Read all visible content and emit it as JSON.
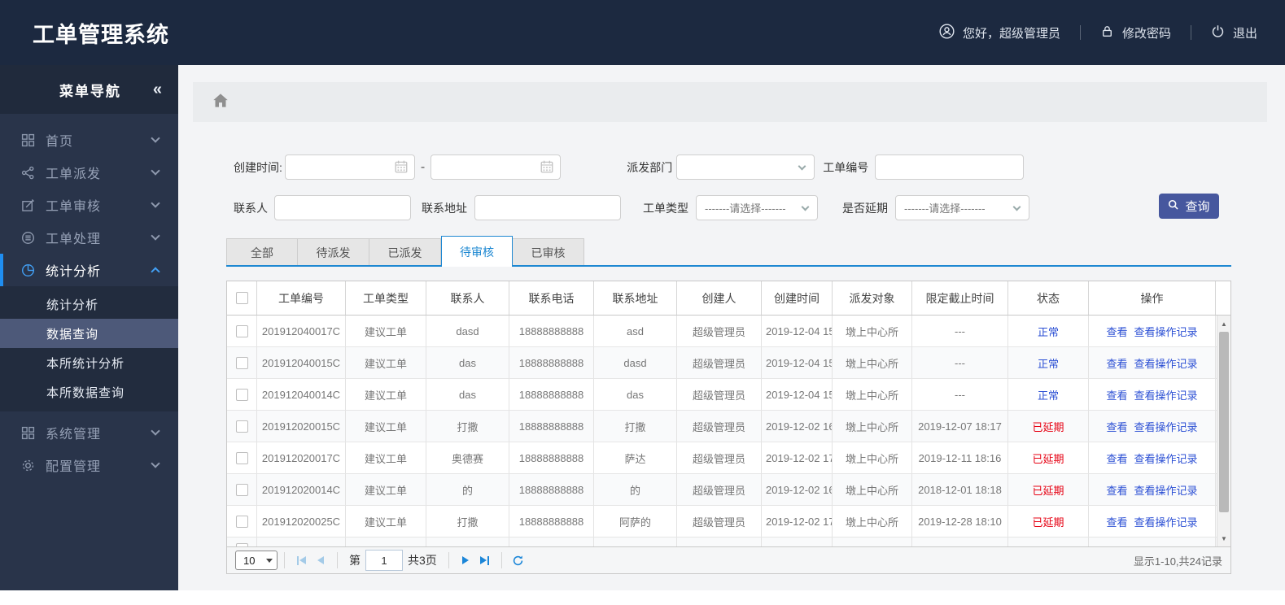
{
  "header": {
    "app_title": "工单管理系统",
    "greeting": "您好，超级管理员",
    "change_password": "修改密码",
    "logout": "退出"
  },
  "sidebar": {
    "title": "菜单导航",
    "collapse": "«",
    "items": [
      {
        "label": "首页",
        "icon": "grid-icon"
      },
      {
        "label": "工单派发",
        "icon": "share-icon"
      },
      {
        "label": "工单审核",
        "icon": "edit-icon"
      },
      {
        "label": "工单处理",
        "icon": "process-icon"
      },
      {
        "label": "统计分析",
        "icon": "pie-chart-icon",
        "expanded": true
      },
      {
        "label": "系统管理",
        "icon": "modules-icon"
      },
      {
        "label": "配置管理",
        "icon": "gear-icon"
      }
    ],
    "submenu": [
      {
        "label": "统计分析",
        "active": false
      },
      {
        "label": "数据查询",
        "active": true
      },
      {
        "label": "本所统计分析",
        "active": false
      },
      {
        "label": "本所数据查询",
        "active": false
      }
    ]
  },
  "filters": {
    "create_time_label": "创建时间:",
    "range_separator": "-",
    "dispatch_dept_label": "派发部门",
    "order_no_label": "工单编号",
    "contact_label": "联系人",
    "address_label": "联系地址",
    "order_type_label": "工单类型",
    "delay_label": "是否延期",
    "select_placeholder": "-------请选择-------",
    "search_button": "查询"
  },
  "tabs": [
    {
      "label": "全部",
      "active": false
    },
    {
      "label": "待派发",
      "active": false
    },
    {
      "label": "已派发",
      "active": false
    },
    {
      "label": "待审核",
      "active": true
    },
    {
      "label": "已审核",
      "active": false
    }
  ],
  "table": {
    "headers": [
      "工单编号",
      "工单类型",
      "联系人",
      "联系电话",
      "联系地址",
      "创建人",
      "创建时间",
      "派发对象",
      "限定截止时间",
      "状态",
      "操作"
    ],
    "actions": [
      "查看",
      "查看操作记录"
    ],
    "rows": [
      {
        "order_no": "201912040017C",
        "type": "建议工单",
        "contact": "dasd",
        "phone": "18888888888",
        "address": "asd",
        "creator": "超级管理员",
        "created": "2019-12-04 15",
        "target": "墩上中心所",
        "deadline": "---",
        "status": "正常",
        "state": "normal"
      },
      {
        "order_no": "201912040015C",
        "type": "建议工单",
        "contact": "das",
        "phone": "18888888888",
        "address": "dasd",
        "creator": "超级管理员",
        "created": "2019-12-04 15",
        "target": "墩上中心所",
        "deadline": "---",
        "status": "正常",
        "state": "normal"
      },
      {
        "order_no": "201912040014C",
        "type": "建议工单",
        "contact": "das",
        "phone": "18888888888",
        "address": "das",
        "creator": "超级管理员",
        "created": "2019-12-04 15",
        "target": "墩上中心所",
        "deadline": "---",
        "status": "正常",
        "state": "normal"
      },
      {
        "order_no": "201912020015C",
        "type": "建议工单",
        "contact": "打撒",
        "phone": "18888888888",
        "address": "打撒",
        "creator": "超级管理员",
        "created": "2019-12-02 16",
        "target": "墩上中心所",
        "deadline": "2019-12-07 18:17",
        "status": "已延期",
        "state": "delayed"
      },
      {
        "order_no": "201912020017C",
        "type": "建议工单",
        "contact": "奥德赛",
        "phone": "18888888888",
        "address": "萨达",
        "creator": "超级管理员",
        "created": "2019-12-02 17",
        "target": "墩上中心所",
        "deadline": "2019-12-11 18:16",
        "status": "已延期",
        "state": "delayed"
      },
      {
        "order_no": "201912020014C",
        "type": "建议工单",
        "contact": "的",
        "phone": "18888888888",
        "address": "的",
        "creator": "超级管理员",
        "created": "2019-12-02 16",
        "target": "墩上中心所",
        "deadline": "2018-12-01 18:18",
        "status": "已延期",
        "state": "delayed"
      },
      {
        "order_no": "201912020025C",
        "type": "建议工单",
        "contact": "打撒",
        "phone": "18888888888",
        "address": "阿萨的",
        "creator": "超级管理员",
        "created": "2019-12-02 17",
        "target": "墩上中心所",
        "deadline": "2019-12-28 18:10",
        "status": "已延期",
        "state": "delayed"
      }
    ]
  },
  "pagination": {
    "page_size": "10",
    "page_prefix": "第",
    "current_page": "1",
    "total_pages": "共3页",
    "summary": "显示1-10,共24记录"
  },
  "colors": {
    "header_navy": "#1c2940",
    "sidebar_navy": "#29344a",
    "submenu_selected": "#4d5979",
    "accent_blue": "#1e88d2",
    "sidebar_accent": "#1f8ef1",
    "link_blue": "#2b4fd4",
    "danger_red": "#e60012",
    "search_button_indigo": "#46579e",
    "content_bg": "#f3f4f6"
  }
}
